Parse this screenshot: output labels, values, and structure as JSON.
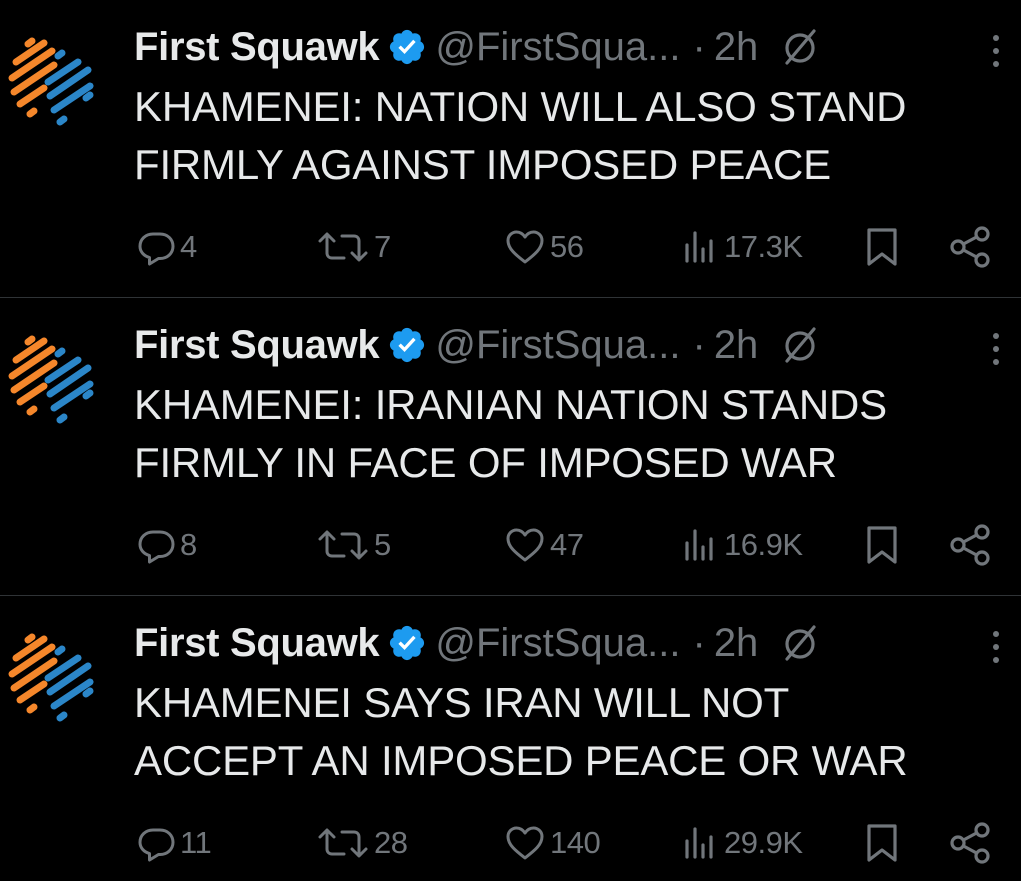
{
  "colors": {
    "background": "#000000",
    "text_primary": "#e7e9ea",
    "text_secondary": "#71767b",
    "verified_blue": "#1d9bf0",
    "divider": "#2f3336",
    "logo_orange": "#f5872b",
    "logo_blue": "#2b86c8"
  },
  "icons": {
    "avatar": "first-squawk-logo",
    "verified": "verified-badge",
    "grok": "grok-icon",
    "more": "more-vertical-icon",
    "reply": "reply-icon",
    "retweet": "retweet-icon",
    "like": "heart-icon",
    "views": "views-icon",
    "bookmark": "bookmark-icon",
    "share": "share-icon"
  },
  "tweets": [
    {
      "author_name": "First Squawk",
      "handle": "@FirstSqua...",
      "separator": "·",
      "time": "2h",
      "text_line1": "KHAMENEI: NATION WILL ALSO STAND",
      "text_line2": "FIRMLY AGAINST IMPOSED PEACE",
      "replies": "4",
      "retweets": "7",
      "likes": "56",
      "views": "17.3K"
    },
    {
      "author_name": "First Squawk",
      "handle": "@FirstSqua...",
      "separator": "·",
      "time": "2h",
      "text_line1": "KHAMENEI: IRANIAN NATION STANDS",
      "text_line2": "FIRMLY IN FACE OF IMPOSED WAR",
      "replies": "8",
      "retweets": "5",
      "likes": "47",
      "views": "16.9K"
    },
    {
      "author_name": "First Squawk",
      "handle": "@FirstSqua...",
      "separator": "·",
      "time": "2h",
      "text_line1": "KHAMENEI SAYS IRAN WILL NOT",
      "text_line2": "ACCEPT AN IMPOSED PEACE OR WAR",
      "replies": "11",
      "retweets": "28",
      "likes": "140",
      "views": "29.9K"
    }
  ]
}
